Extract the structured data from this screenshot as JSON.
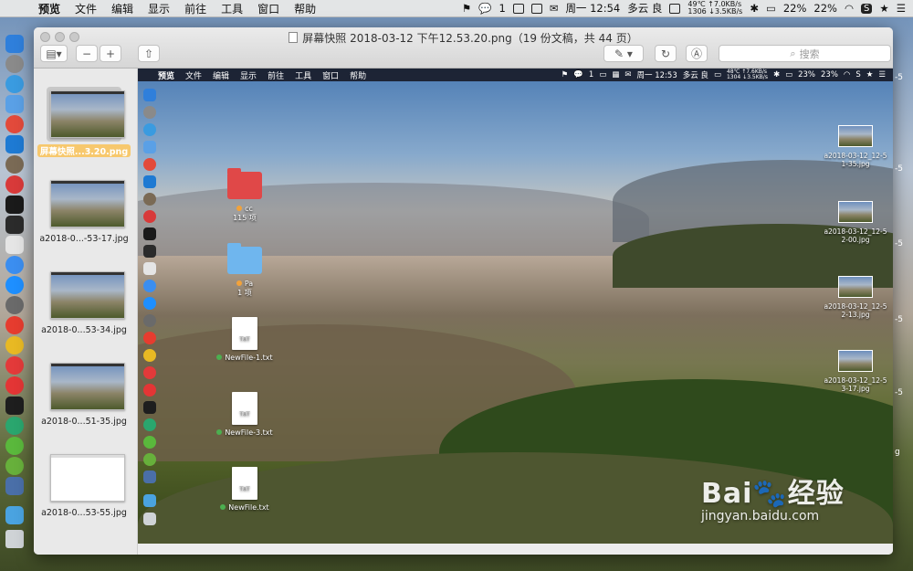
{
  "menubar": {
    "items": [
      "预览",
      "文件",
      "编辑",
      "显示",
      "前往",
      "工具",
      "窗口",
      "帮助"
    ],
    "wechat_count": "1",
    "clock": "周一 12:54",
    "weather": "多云 良",
    "temp": "49℃",
    "net_up": "↑7.0KB/s",
    "mem": "1306",
    "net_down": "↓3.5KB/s",
    "cpu": "22%",
    "battery": "22%"
  },
  "window": {
    "title": "屏幕快照 2018-03-12 下午12.53.20.png（19 份文稿，共 44 页）",
    "search_placeholder": "搜索"
  },
  "sidebar": {
    "items": [
      {
        "label": "屏幕快照...3.20.png",
        "selected": true
      },
      {
        "label": "a2018-0...-53-17.jpg"
      },
      {
        "label": "a2018-0...53-34.jpg"
      },
      {
        "label": "a2018-0...51-35.jpg"
      },
      {
        "label": "a2018-0...53-55.jpg"
      }
    ]
  },
  "inner": {
    "menubar": {
      "items": [
        "预览",
        "文件",
        "编辑",
        "显示",
        "前往",
        "工具",
        "窗口",
        "帮助"
      ],
      "wechat_count": "1",
      "clock": "周一 12:53",
      "weather": "多云 良",
      "temp": "48℃",
      "net_up": "↑7.6KB/s",
      "mem": "1304",
      "net_down": "↓3.5KB/s",
      "cpu": "23%",
      "battery": "23%"
    },
    "files": [
      {
        "name": "cc",
        "sub": "115 项",
        "kind": "folder",
        "color": "#e04848",
        "dot": "#f2a23a"
      },
      {
        "name": "Pa",
        "sub": "1 项",
        "kind": "folder",
        "color": "#6fb6ee",
        "dot": "#f2a23a"
      },
      {
        "name": "NewFile-1.txt",
        "kind": "txt",
        "type_label": "TXT",
        "dot": "#4caf50"
      },
      {
        "name": "NewFile-3.txt",
        "kind": "txt",
        "type_label": "TXT",
        "dot": "#4caf50"
      },
      {
        "name": "NewFile.txt",
        "kind": "txt",
        "type_label": "TXT",
        "dot": "#4caf50"
      }
    ],
    "right_files": [
      {
        "line1": "a2018-03-12_12-5",
        "line2": "1-35.jpg"
      },
      {
        "line1": "a2018-03-12_12-5",
        "line2": "2-00.jpg"
      },
      {
        "line1": "a2018-03-12_12-5",
        "line2": "2-13.jpg"
      },
      {
        "line1": "a2018-03-12_12-5",
        "line2": "3-17.jpg"
      }
    ]
  },
  "watermark": {
    "brand": "Bai",
    "brand2": "经验",
    "url": "jingyan.baidu.com"
  },
  "edge_labels": [
    "-5",
    "-5",
    "-5",
    "-5",
    "-5",
    "-5",
    "-5",
    "g"
  ]
}
